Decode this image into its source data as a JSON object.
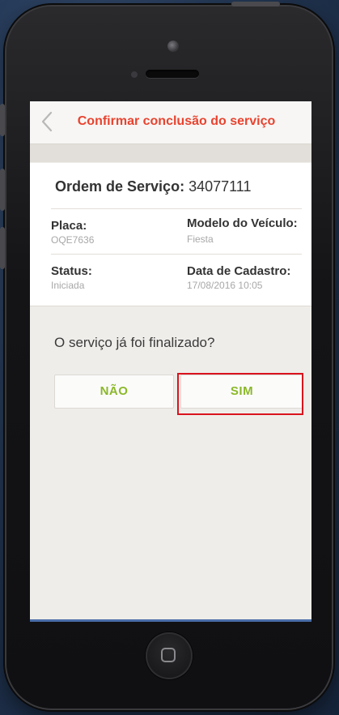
{
  "navbar": {
    "back_icon": "chevron-left-icon",
    "title": "Confirmar conclusão do serviço"
  },
  "order": {
    "label": "Ordem de Serviço:",
    "number": "34077111"
  },
  "fields": {
    "placa": {
      "label": "Placa:",
      "value": "OQE7636"
    },
    "modelo": {
      "label": "Modelo do Veículo:",
      "value": "Fiesta"
    },
    "status": {
      "label": "Status:",
      "value": "Iniciada"
    },
    "data_cadastro": {
      "label": "Data de Cadastro:",
      "value": "17/08/2016 10:05"
    }
  },
  "question": "O serviço já foi finalizado?",
  "buttons": {
    "no_label": "NÃO",
    "yes_label": "SIM"
  },
  "colors": {
    "title_red": "#e8432f",
    "button_green": "#8bb82a",
    "highlight_red": "#d9141e"
  }
}
